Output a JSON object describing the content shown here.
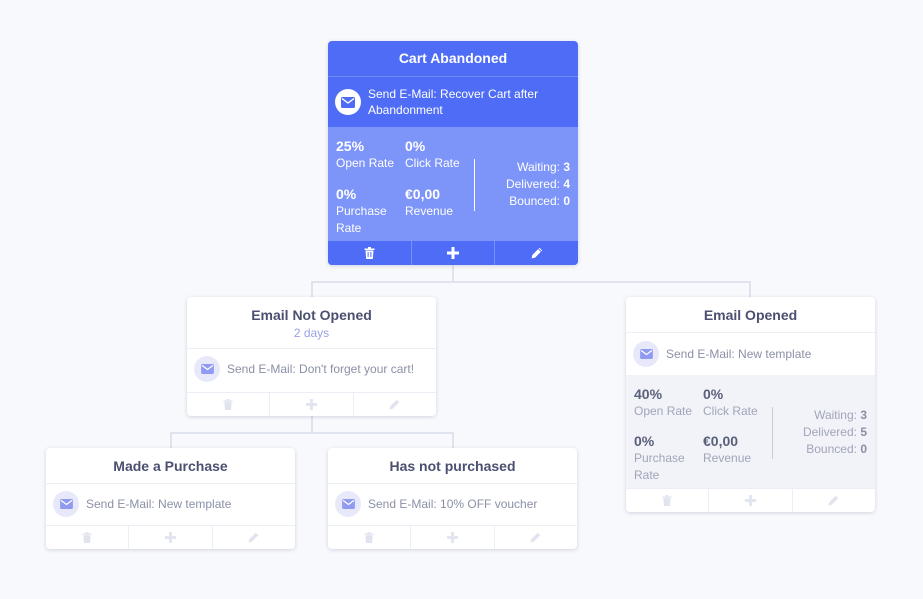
{
  "colors": {
    "accent": "#4e6cf6",
    "accent_light": "#7d94f8",
    "delay_text": "#9aa2e8",
    "background": "#f8f9fd"
  },
  "root": {
    "title": "Cart Abandoned",
    "action": "Send E-Mail: Recover Cart after Abandonment",
    "open_rate_value": "25%",
    "open_rate_label": "Open Rate",
    "click_rate_value": "0%",
    "click_rate_label": "Click Rate",
    "purchase_rate_value": "0%",
    "purchase_rate_label": "Purchase Rate",
    "revenue_value": "€0,00",
    "revenue_label": "Revenue",
    "waiting_label": "Waiting:",
    "waiting_value": "3",
    "delivered_label": "Delivered:",
    "delivered_value": "4",
    "bounced_label": "Bounced:",
    "bounced_value": "0"
  },
  "not_opened": {
    "title": "Email Not Opened",
    "delay": "2 days",
    "action": "Send E-Mail: Don't forget your cart!"
  },
  "opened": {
    "title": "Email Opened",
    "action": "Send E-Mail: New template",
    "open_rate_value": "40%",
    "open_rate_label": "Open Rate",
    "click_rate_value": "0%",
    "click_rate_label": "Click Rate",
    "purchase_rate_value": "0%",
    "purchase_rate_label": "Purchase Rate",
    "revenue_value": "€0,00",
    "revenue_label": "Revenue",
    "waiting_label": "Waiting:",
    "waiting_value": "3",
    "delivered_label": "Delivered:",
    "delivered_value": "5",
    "bounced_label": "Bounced:",
    "bounced_value": "0"
  },
  "purchased": {
    "title": "Made a Purchase",
    "action": "Send E-Mail: New template"
  },
  "not_purchased": {
    "title": "Has not purchased",
    "action": "Send E-Mail: 10% OFF voucher"
  },
  "icons": {
    "action": "email-icon",
    "toolbar": [
      "trash-icon",
      "plus-icon",
      "pencil-icon"
    ]
  }
}
